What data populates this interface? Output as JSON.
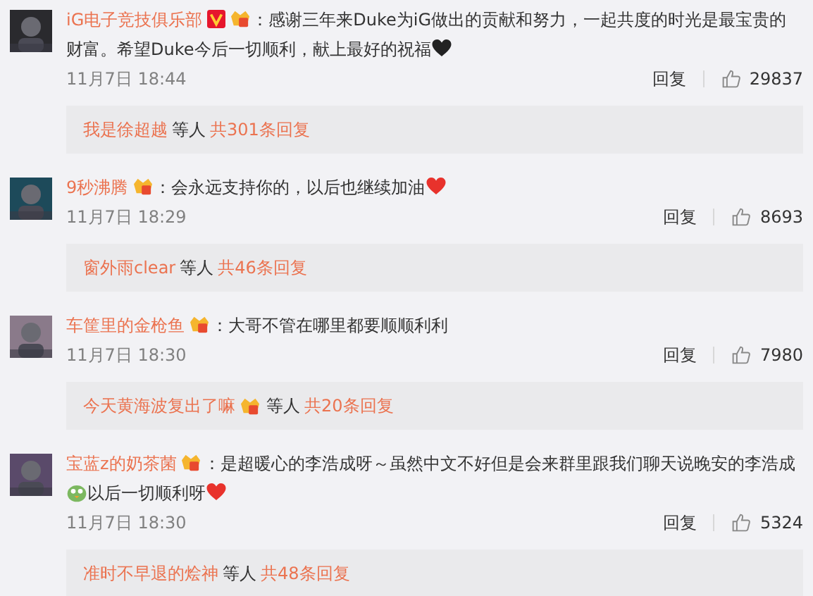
{
  "comments": [
    {
      "name": "iG电子竞技俱乐部",
      "verified": true,
      "crown": true,
      "parts": [
        {
          "kind": "text",
          "text": "：感谢三年来Duke为iG做出的贡献和努力，一起共度的时光是最宝贵的财富。希望Duke今后一切顺利，献上最好的祝福"
        },
        {
          "kind": "dark-heart"
        }
      ],
      "time": "11月7日 18:44",
      "reply": "回复",
      "likes": "29837",
      "thread": {
        "user": "我是徐超越",
        "crown": false,
        "middle": "等人",
        "total": "共301条回复"
      }
    },
    {
      "name": "9秒沸腾",
      "verified": false,
      "crown": true,
      "parts": [
        {
          "kind": "text",
          "text": "：会永远支持你的，以后也继续加油"
        },
        {
          "kind": "red-heart"
        }
      ],
      "time": "11月7日 18:29",
      "reply": "回复",
      "likes": "8693",
      "thread": {
        "user": "窗外雨clear",
        "crown": false,
        "middle": "等人",
        "total": "共46条回复"
      }
    },
    {
      "name": "车筐里的金枪鱼",
      "verified": false,
      "crown": true,
      "parts": [
        {
          "kind": "text",
          "text": "：大哥不管在哪里都要顺顺利利"
        }
      ],
      "time": "11月7日 18:30",
      "reply": "回复",
      "likes": "7980",
      "thread": {
        "user": "今天黄海波复出了嘛",
        "crown": true,
        "middle": "等人",
        "total": "共20条回复"
      }
    },
    {
      "name": "宝蓝z的奶茶菌",
      "verified": false,
      "crown": true,
      "parts": [
        {
          "kind": "text",
          "text": "：是超暖心的李浩成呀～虽然中文不好但是会来群里跟我们聊天说晚安的李浩成"
        },
        {
          "kind": "bird"
        },
        {
          "kind": "text",
          "text": "以后一切顺利呀"
        },
        {
          "kind": "red-heart"
        }
      ],
      "time": "11月7日 18:30",
      "reply": "回复",
      "likes": "5324",
      "thread": {
        "user": "准时不早退的烩神",
        "crown": false,
        "middle": "等人",
        "total": "共48条回复"
      }
    }
  ]
}
